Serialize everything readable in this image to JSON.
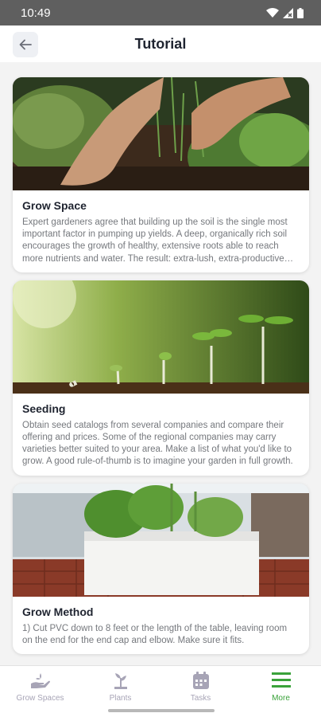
{
  "status_bar": {
    "time": "10:49"
  },
  "header": {
    "title": "Tutorial",
    "back_icon": "arrow-left-icon"
  },
  "cards": [
    {
      "title": "Grow Space",
      "description": "Expert gardeners agree that building up the soil is the single most important factor in pumping up yields. A deep, organically rich soil encourages the growth of healthy, extensive roots able to reach more nutrients and water. The result: extra-lush, extra-productive growth above ground.",
      "image": "hands-planting-seedlings"
    },
    {
      "title": "Seeding",
      "description": "Obtain seed catalogs from several companies and compare their offering and prices. Some of the regional companies may carry varieties better suited to your area. Make a list of what you'd like to grow. A good rule-of-thumb is to imagine your garden in full growth.",
      "image": "sprouting-seedlings"
    },
    {
      "title": "Grow Method",
      "description": "1) Cut PVC down to 8 feet or the length of the table, leaving room on the end for the end cap and elbow. Make sure it fits.",
      "image": "white-planter-box"
    }
  ],
  "bottom_nav": [
    {
      "label": "Grow Spaces",
      "icon": "hand-plant-icon",
      "active": false
    },
    {
      "label": "Plants",
      "icon": "sprout-icon",
      "active": false
    },
    {
      "label": "Tasks",
      "icon": "calendar-icon",
      "active": false
    },
    {
      "label": "More",
      "icon": "menu-icon",
      "active": true
    }
  ],
  "colors": {
    "accent": "#3aa23a",
    "nav_inactive": "#a7a4b6",
    "status_bar": "#5f5f5f"
  }
}
